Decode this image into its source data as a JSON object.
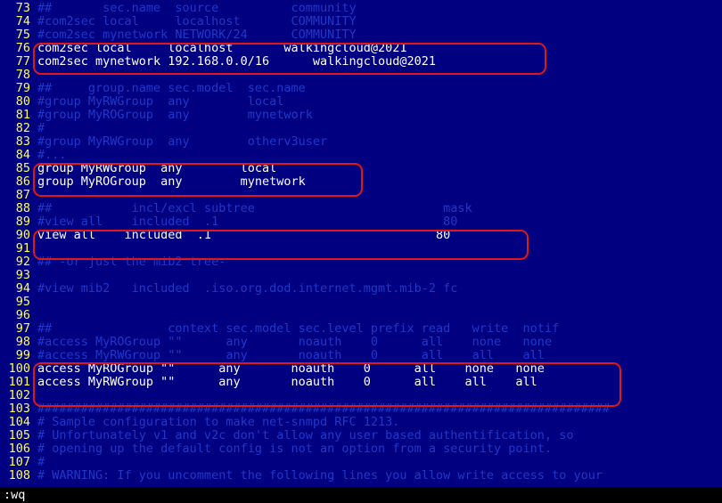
{
  "editor": {
    "lines": [
      {
        "n": "73",
        "text": "##       sec.name  source          community",
        "kind": "cmt"
      },
      {
        "n": "74",
        "text": "#com2sec local     localhost       COMMUNITY",
        "kind": "cmt"
      },
      {
        "n": "75",
        "text": "#com2sec mynetwork NETWORK/24      COMMUNITY",
        "kind": "cmt"
      },
      {
        "n": "76",
        "text": "com2sec local     localhost       walkingcloud@2021",
        "kind": "cfg"
      },
      {
        "n": "77",
        "text": "com2sec mynetwork 192.168.0.0/16      walkingcloud@2021",
        "kind": "cfg"
      },
      {
        "n": "78",
        "text": "",
        "kind": "cfg"
      },
      {
        "n": "79",
        "text": "##     group.name sec.model  sec.name",
        "kind": "cmt"
      },
      {
        "n": "80",
        "text": "#group MyRWGroup  any        local",
        "kind": "cmt"
      },
      {
        "n": "81",
        "text": "#group MyROGroup  any        mynetwork",
        "kind": "cmt"
      },
      {
        "n": "82",
        "text": "#",
        "kind": "cmt"
      },
      {
        "n": "83",
        "text": "#group MyRWGroup  any        otherv3user",
        "kind": "cmt"
      },
      {
        "n": "84",
        "text": "#...",
        "kind": "cmt"
      },
      {
        "n": "85",
        "text": "group MyRWGroup  any        local",
        "kind": "cfg"
      },
      {
        "n": "86",
        "text": "group MyROGroup  any        mynetwork",
        "kind": "cfg"
      },
      {
        "n": "87",
        "text": "",
        "kind": "cfg"
      },
      {
        "n": "88",
        "text": "##           incl/excl subtree                          mask",
        "kind": "cmt"
      },
      {
        "n": "89",
        "text": "#view all    included  .1                               80",
        "kind": "cmt"
      },
      {
        "n": "90",
        "text": "view all    included  .1                               80",
        "kind": "cfg"
      },
      {
        "n": "91",
        "text": "",
        "kind": "cfg"
      },
      {
        "n": "92",
        "text": "## -or just the mib2 tree-",
        "kind": "cmt"
      },
      {
        "n": "93",
        "text": "",
        "kind": "cfg"
      },
      {
        "n": "94",
        "text": "#view mib2   included  .iso.org.dod.internet.mgmt.mib-2 fc",
        "kind": "cmt"
      },
      {
        "n": "95",
        "text": "",
        "kind": "cfg"
      },
      {
        "n": "96",
        "text": "",
        "kind": "cfg"
      },
      {
        "n": "97",
        "text": "##                context sec.model sec.level prefix read   write  notif",
        "kind": "cmt"
      },
      {
        "n": "98",
        "text": "#access MyROGroup \"\"      any       noauth    0      all    none   none",
        "kind": "cmt"
      },
      {
        "n": "99",
        "text": "#access MyRWGroup \"\"      any       noauth    0      all    all    all",
        "kind": "cmt"
      },
      {
        "n": "100",
        "text": "access MyROGroup \"\"      any       noauth    0      all    none   none",
        "kind": "cfg"
      },
      {
        "n": "101",
        "text": "access MyRWGroup \"\"      any       noauth    0      all    all    all",
        "kind": "cfg"
      },
      {
        "n": "102",
        "text": "",
        "kind": "cfg"
      },
      {
        "n": "103",
        "text": "###############################################################################",
        "kind": "cmt"
      },
      {
        "n": "104",
        "text": "# Sample configuration to make net-snmpd RFC 1213.",
        "kind": "cmt"
      },
      {
        "n": "105",
        "text": "# Unfortunately v1 and v2c don't allow any user based authentification, so",
        "kind": "cmt"
      },
      {
        "n": "106",
        "text": "# opening up the default config is not an option from a security point.",
        "kind": "cmt"
      },
      {
        "n": "107",
        "text": "#",
        "kind": "cmt"
      },
      {
        "n": "108",
        "text": "# WARNING: If you uncomment the following lines you allow write access to your",
        "kind": "cmt"
      }
    ],
    "command_line": ":wq"
  },
  "colors": {
    "background": "#000080",
    "line_number": "#ffff55",
    "comment_text": "#1f38c9",
    "config_text": "#ffffff",
    "highlight_box": "#e01818"
  }
}
